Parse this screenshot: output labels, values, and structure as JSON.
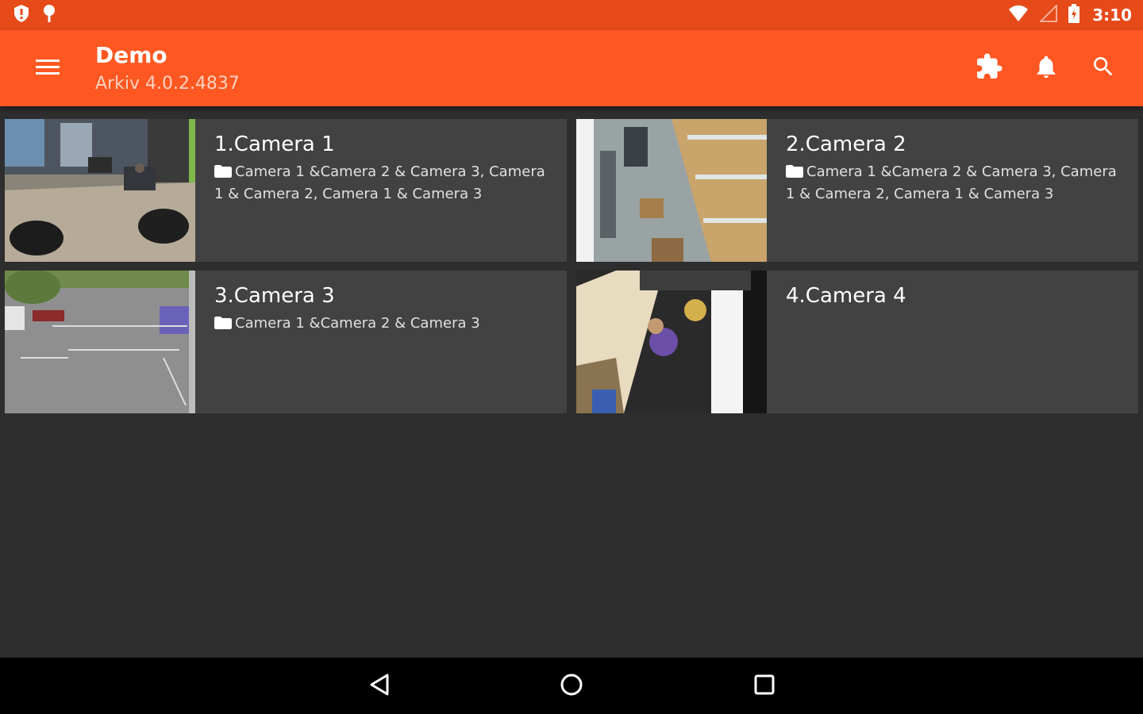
{
  "status_bar": {
    "time": "3:10",
    "icons": [
      "shield-icon",
      "location-pin-icon",
      "wifi-icon",
      "cell-signal-icon",
      "battery-icon"
    ]
  },
  "app_bar": {
    "title": "Demo",
    "subtitle": "Arkiv 4.0.2.4837",
    "icons": [
      "menu-icon",
      "plugin-icon",
      "bell-icon",
      "search-icon"
    ]
  },
  "cameras": [
    {
      "title": "1.Camera 1",
      "groups": "Camera 1 &Camera 2 & Camera 3, Camera 1 & Camera 2, Camera 1 & Camera 3",
      "thumbnail": "lobby-camera-feed"
    },
    {
      "title": "2.Camera 2",
      "groups": "Camera 1 &Camera 2 & Camera 3, Camera 1 & Camera 2, Camera 1 & Camera 3",
      "thumbnail": "warehouse-camera-feed"
    },
    {
      "title": "3.Camera 3",
      "groups": "Camera 1 &Camera 2 & Camera 3",
      "thumbnail": "parking-lot-camera-feed"
    },
    {
      "title": "4.Camera 4",
      "groups": "",
      "thumbnail": "overhead-camera-feed"
    }
  ],
  "nav_bar": {
    "icons": [
      "back-icon",
      "home-icon",
      "recents-icon"
    ]
  },
  "colors": {
    "status_bar": "#e64a19",
    "app_bar": "#ff5722",
    "background": "#2e2e2e",
    "card": "#424242"
  }
}
